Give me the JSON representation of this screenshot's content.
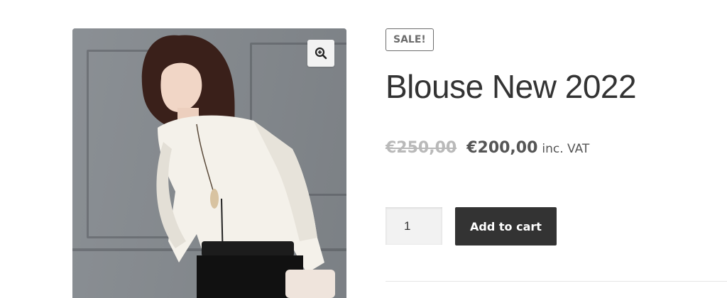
{
  "product": {
    "sale_badge": "SALE!",
    "title": "Blouse New 2022",
    "old_price": "€250,00",
    "new_price": "€200,00",
    "vat_suffix": "inc. VAT",
    "quantity": "1",
    "add_to_cart": "Add to cart"
  },
  "gallery": {
    "zoom_icon": "zoom-in-icon",
    "image_subject": "woman-in-white-blouse"
  },
  "colors": {
    "button_bg": "#333333",
    "badge_border": "#6d6d6d",
    "strike_price": "#b9b9b9"
  }
}
